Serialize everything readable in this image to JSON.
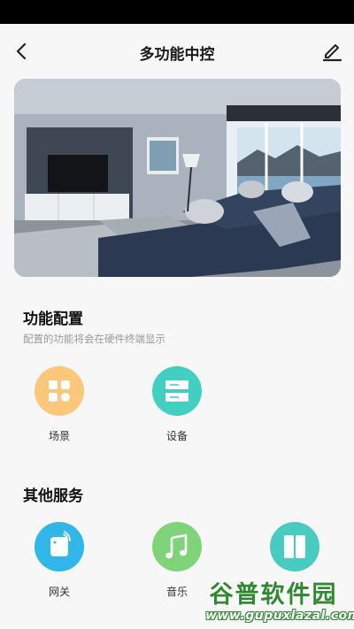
{
  "header": {
    "title": "多功能中控",
    "back_icon": "chevron-left-icon",
    "edit_icon": "pencil-icon"
  },
  "function_config": {
    "title": "功能配置",
    "subtitle": "配置的功能将会在硬件终端显示",
    "items": [
      {
        "label": "场景",
        "icon": "grid-icon",
        "color": "#fbc778"
      },
      {
        "label": "设备",
        "icon": "device-list-icon",
        "color": "#3fd0c0"
      }
    ]
  },
  "other_services": {
    "title": "其他服务",
    "items": [
      {
        "label": "网关",
        "icon": "gateway-icon",
        "color": "#2fb7ea"
      },
      {
        "label": "音乐",
        "icon": "music-note-icon",
        "color": "#7fd47a"
      },
      {
        "label": "",
        "icon": "door-panel-icon",
        "color": "#46ccc0"
      }
    ]
  },
  "watermark": {
    "text": "谷普软件园",
    "url": "www.gupuxlazal.com"
  }
}
